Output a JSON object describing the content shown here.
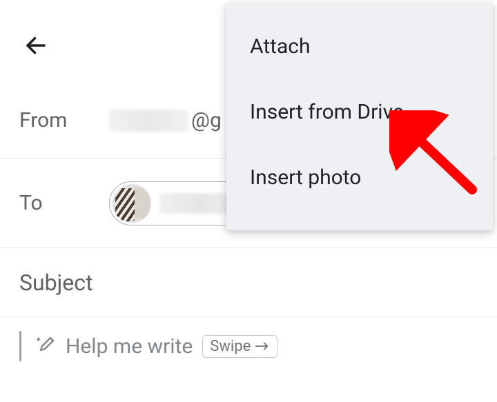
{
  "header": {
    "back_aria": "Back"
  },
  "from": {
    "label": "From",
    "domain_suffix": "@g"
  },
  "to": {
    "label": "To"
  },
  "subject": {
    "placeholder": "Subject"
  },
  "compose_assist": {
    "help_me_write": "Help me write",
    "swipe_label": "Swipe"
  },
  "menu": {
    "items": [
      {
        "label": "Attach"
      },
      {
        "label": "Insert from Drive"
      },
      {
        "label": "Insert photo"
      }
    ]
  },
  "annotation": {
    "arrow_color": "#ff0000"
  }
}
